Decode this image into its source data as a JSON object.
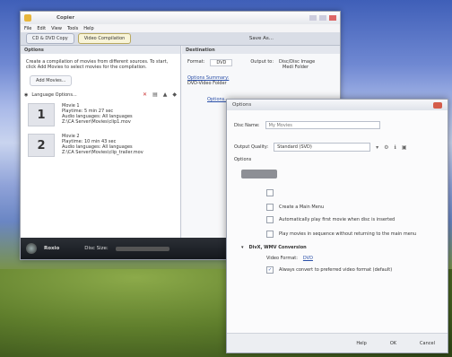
{
  "window": {
    "title": "Copier",
    "menu": [
      "File",
      "Edit",
      "View",
      "Tools",
      "Help"
    ],
    "tabs": [
      "CD & DVD Copy",
      "Video Compilation"
    ],
    "save_as": "Save As..."
  },
  "left_panel": {
    "header": "Options",
    "description": "Create a compilation of movies from different sources. To start, click Add Movies to select movies for the compilation.",
    "add_movies": "Add Movies...",
    "language_options": "Language Options...",
    "movies": [
      {
        "number": "1",
        "name": "Movie 1",
        "playtime": "Playtime: 5 min 27 sec",
        "audio": "Audio languages: All languages",
        "path": "Z:\\CA Server\\Movies\\clip1.mov"
      },
      {
        "number": "2",
        "name": "Movie 2",
        "playtime": "Playtime: 10 min 43 sec",
        "audio": "Audio languages: All languages",
        "path": "Z:\\CA Server\\Movies\\clip_trailer.mov"
      }
    ]
  },
  "right_panel": {
    "header": "Destination",
    "format_label": "Format:",
    "format_value": "DVD",
    "output_to_label": "Output to:",
    "output_to_value": "Disc/Disc Image",
    "output_sub": "Medi Folder",
    "options_summary": "Options Summary:",
    "summary_value": "DVD-Video Folder",
    "options_button": "Options..."
  },
  "status_bar": {
    "brand": "Roxio",
    "disc_size_label": "Disc Size:"
  },
  "dialog": {
    "title": "Options",
    "disc_name_label": "Disc Name:",
    "disc_name_value": "My Movies",
    "output_quality_label": "Output Quality:",
    "output_quality_value": "Standard (SVD)",
    "options_label": "Options",
    "create_main_menu": "Create a Main Menu",
    "autoplay": "Automatically play first movie when disc is inserted",
    "play_sequence": "Play movies in sequence without returning to the main menu",
    "conversion_header": "DivX, WMV Conversion",
    "video_format_label": "Video Format:",
    "video_format_value": "DVD",
    "always_convert": "Always convert to preferred video format (default)",
    "help": "Help",
    "ok": "OK",
    "cancel": "Cancel"
  },
  "colors": {
    "active_tab": "#f8f4d8",
    "status_bar": "#1d2026",
    "link": "#2a4fa8"
  }
}
